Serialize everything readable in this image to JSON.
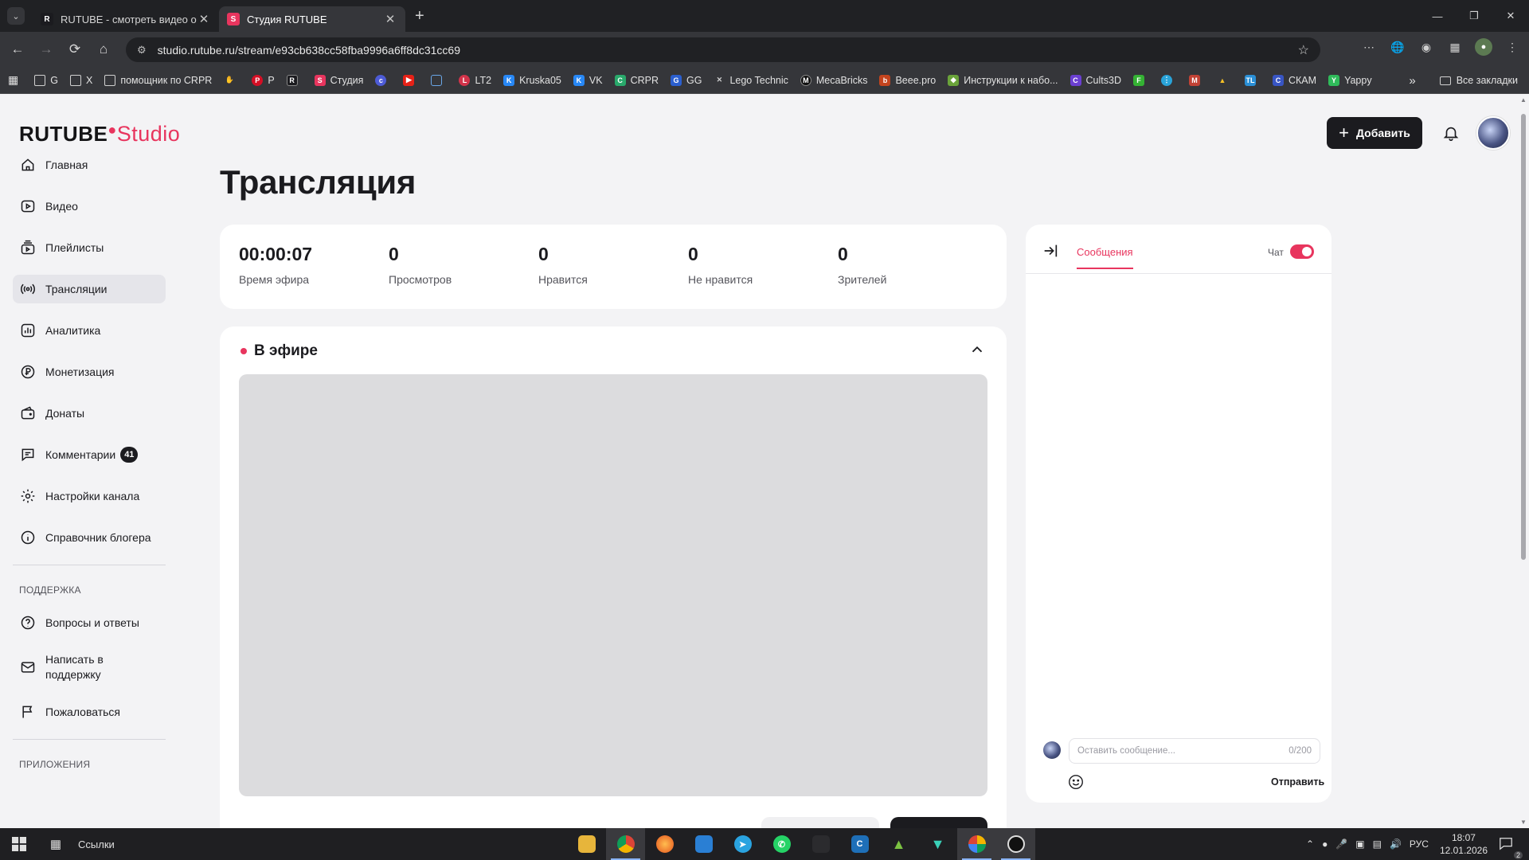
{
  "browser": {
    "tabs": [
      {
        "title": "RUTUBE - смотреть видео онлайн",
        "favicon": "R",
        "active": false
      },
      {
        "title": "Студия RUTUBE",
        "favicon": "S",
        "active": true
      }
    ],
    "url": "studio.rutube.ru/stream/e93cb638cc58fba9996a6ff8dc31cc69",
    "bookmarks": [
      {
        "label": "G",
        "icon": "folder-icon"
      },
      {
        "label": "X",
        "icon": "folder-icon"
      },
      {
        "label": "помощник по CRPR",
        "icon": "folder-icon"
      },
      {
        "label": "",
        "icon": "hand-icon"
      },
      {
        "label": "P",
        "icon": "pinterest-icon"
      },
      {
        "label": "",
        "icon": "rutube-icon"
      },
      {
        "label": "Студия",
        "icon": "studio-icon"
      },
      {
        "label": "",
        "icon": "ru-icon"
      },
      {
        "label": "",
        "icon": "youtube-icon"
      },
      {
        "label": "",
        "icon": "grid-icon"
      },
      {
        "label": "LT2",
        "icon": "lt2-icon"
      },
      {
        "label": "Kruska05",
        "icon": "vk-icon"
      },
      {
        "label": "VK",
        "icon": "vk-icon"
      },
      {
        "label": "CRPR",
        "icon": "crpr-icon"
      },
      {
        "label": "GG",
        "icon": "gg-icon"
      },
      {
        "label": "Lego Technic",
        "icon": "lego-icon"
      },
      {
        "label": "MecaBricks",
        "icon": "mecabricks-icon"
      },
      {
        "label": "Beee.pro",
        "icon": "beee-icon"
      },
      {
        "label": "Инструкции к набо...",
        "icon": "instructions-icon"
      },
      {
        "label": "Cults3D",
        "icon": "cults-icon"
      },
      {
        "label": "",
        "icon": "f-icon"
      },
      {
        "label": "",
        "icon": "dots-icon"
      },
      {
        "label": "",
        "icon": "gmail-icon"
      },
      {
        "label": "",
        "icon": "drive-icon"
      },
      {
        "label": "",
        "icon": "tl-icon"
      },
      {
        "label": "СКАМ",
        "icon": "skam-icon"
      },
      {
        "label": "Yappy",
        "icon": "yappy-icon"
      }
    ],
    "all_bookmarks": "Все закладки"
  },
  "app": {
    "logo_main": "RUTUBE",
    "logo_sub": "Studio",
    "add_button": "Добавить",
    "page_title": "Трансляция"
  },
  "sidebar": {
    "items": [
      {
        "label": "Главная",
        "icon": "home-icon"
      },
      {
        "label": "Видео",
        "icon": "video-icon"
      },
      {
        "label": "Плейлисты",
        "icon": "playlist-icon"
      },
      {
        "label": "Трансляции",
        "icon": "broadcast-icon",
        "active": true
      },
      {
        "label": "Аналитика",
        "icon": "analytics-icon"
      },
      {
        "label": "Монетизация",
        "icon": "ruble-icon"
      },
      {
        "label": "Донаты",
        "icon": "wallet-icon"
      },
      {
        "label": "Комментарии",
        "icon": "comment-icon",
        "badge": "41"
      },
      {
        "label": "Настройки канала",
        "icon": "gear-icon"
      },
      {
        "label": "Справочник блогера",
        "icon": "info-icon"
      }
    ],
    "support_heading": "ПОДДЕРЖКА",
    "support_items": [
      {
        "label": "Вопросы и ответы",
        "icon": "question-icon"
      },
      {
        "label": "Написать в поддержку",
        "icon": "mail-icon"
      },
      {
        "label": "Пожаловаться",
        "icon": "flag-icon"
      }
    ],
    "apps_heading": "ПРИЛОЖЕНИЯ"
  },
  "stats": [
    {
      "value": "00:00:07",
      "label": "Время эфира"
    },
    {
      "value": "0",
      "label": "Просмотров"
    },
    {
      "value": "0",
      "label": "Нравится"
    },
    {
      "value": "0",
      "label": "Не нравится"
    },
    {
      "value": "0",
      "label": "Зрителей"
    }
  ],
  "live": {
    "heading": "В эфире"
  },
  "chat": {
    "tab": "Сообщения",
    "toggle_label": "Чат",
    "toggle_on": true,
    "placeholder": "Оставить сообщение...",
    "counter": "0/200",
    "send": "Отправить"
  },
  "taskbar": {
    "links": "Ссылки",
    "lang": "РУС",
    "time": "18:07",
    "date": "12.01.2026",
    "notifications": "2"
  },
  "colors": {
    "accent": "#e8355e",
    "dark": "#1b1b1f",
    "page_bg": "#f3f3f5"
  }
}
